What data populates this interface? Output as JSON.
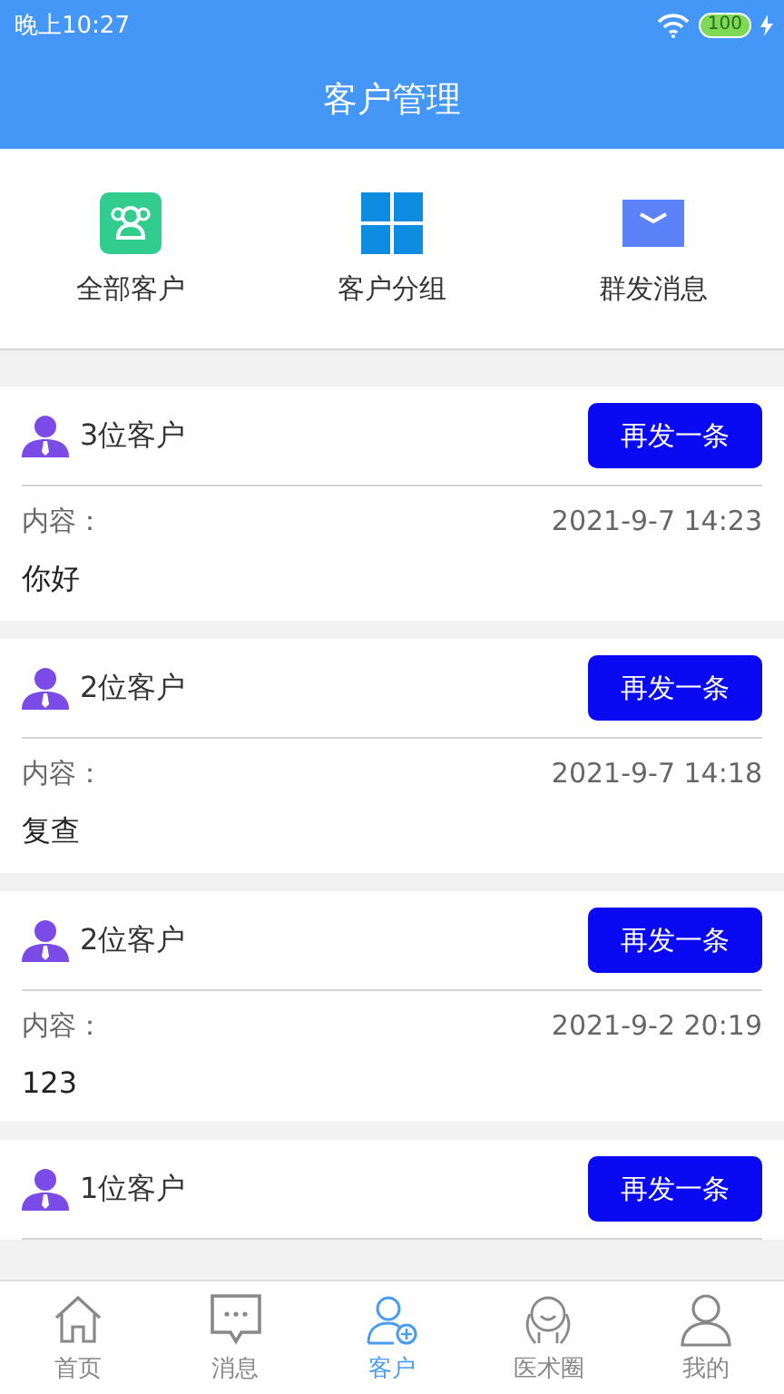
{
  "status_bar": {
    "time": "晚上10:27",
    "battery": "100"
  },
  "header": {
    "title": "客户管理"
  },
  "actions": [
    {
      "kind": "people",
      "label": "全部客户"
    },
    {
      "kind": "grid",
      "label": "客户分组"
    },
    {
      "kind": "mail",
      "label": "群发消息"
    }
  ],
  "records": [
    {
      "recipients": "3位客户",
      "button": "再发一条",
      "content_label": "内容：",
      "time": "2021-9-7 14:23",
      "content": "你好"
    },
    {
      "recipients": "2位客户",
      "button": "再发一条",
      "content_label": "内容：",
      "time": "2021-9-7 14:18",
      "content": "复查"
    },
    {
      "recipients": "2位客户",
      "button": "再发一条",
      "content_label": "内容：",
      "time": "2021-9-2 20:19",
      "content": "123"
    },
    {
      "recipients": "1位客户",
      "button": "再发一条"
    }
  ],
  "tab_bar": [
    {
      "kind": "home",
      "label": "首页",
      "selected": false
    },
    {
      "kind": "chat",
      "label": "消息",
      "selected": false
    },
    {
      "kind": "client",
      "label": "客户",
      "selected": true
    },
    {
      "kind": "circle",
      "label": "医术圈",
      "selected": false
    },
    {
      "kind": "me",
      "label": "我的",
      "selected": false
    }
  ]
}
